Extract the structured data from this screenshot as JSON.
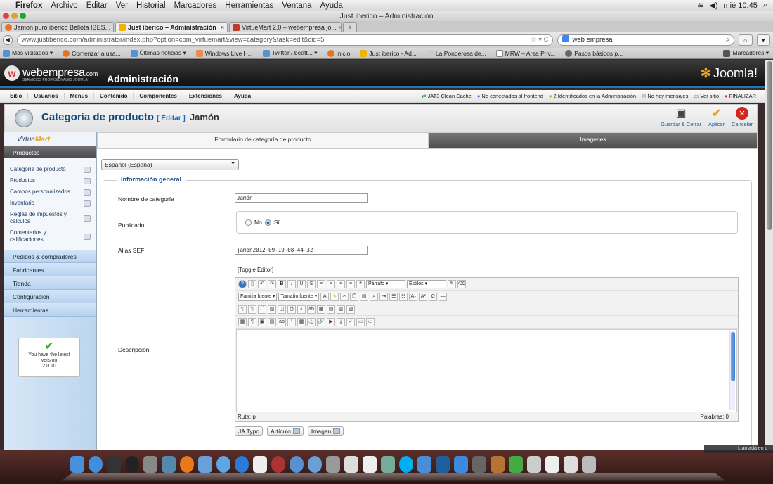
{
  "mac_menubar": {
    "app": "Firefox",
    "items": [
      "Archivo",
      "Editar",
      "Ver",
      "Historial",
      "Marcadores",
      "Herramientas",
      "Ventana",
      "Ayuda"
    ],
    "clock": "mié 10:45"
  },
  "window_title": "Just iberico – Administración",
  "browser_tabs": [
    {
      "label": "Jamon puro ibérico Bellota IBES...",
      "color": "#e8731c"
    },
    {
      "label": "Just iberico – Administración",
      "color": "#f0b400"
    },
    {
      "label": "VirtueMart 2.0 – webempresa jo...",
      "color": "#c0392b"
    }
  ],
  "url": "www.justiberico.com/administrator/index.php?option=com_virtuemart&view=category&task=edit&cid=5",
  "search_box": "web empresa",
  "bookmarks": [
    "Más visitados ▾",
    "Comenzar a usa...",
    "Últimas noticias ▾",
    "Windows Live H...",
    "Twitter / beatt... ▾",
    "Inicio",
    "Just iberico - Ad...",
    "La Ponderosa de...",
    "MRW – Area Priv...",
    "Pasos básicos p..."
  ],
  "bookmarks_menu": "Marcadores ▾",
  "joomla_header": {
    "brand": "webempresa",
    "brand_suffix": ".com",
    "brand_sub": "SERVICIOS PROFESIONALES JOOMLA",
    "title": "Administración",
    "joomla_logo": "Joomla!"
  },
  "admin_menu": [
    "Sitio",
    "Usuarios",
    "Menús",
    "Contenido",
    "Componentes",
    "Extensiones",
    "Ayuda"
  ],
  "admin_status": [
    "JAT3 Clean Cache",
    "No conectados al frontend",
    "2 Identificados en la Administración",
    "No hay mensajes",
    "Ver sitio",
    "FINALIZAR"
  ],
  "toolbar": {
    "title": "Categoría de producto",
    "edit_tag": "[ Editar ]",
    "item_name": "Jamón",
    "save_close": "Guardar & Cerrar",
    "apply": "Aplicar",
    "cancel": "Cancelar"
  },
  "sidebar": {
    "logo_a": "Virtue",
    "logo_b": "Mart",
    "active_section": "Productos",
    "subitems": [
      "Categoría de producto",
      "Productos",
      "Campos personalizados",
      "Inventario",
      "Reglas de impuestos y cálculos",
      "Comentarios y calificaciones"
    ],
    "sections": [
      "Pedidos & compradores",
      "Fabricantes",
      "Tienda",
      "Configuración",
      "Herramientas"
    ],
    "version_box": {
      "line1": "You have the latest",
      "line2": "version",
      "version": "2.0.10"
    }
  },
  "form_tabs": [
    "Formulario de categoría de producto",
    "Imagenes"
  ],
  "language_select": "Español (España)",
  "general_info": {
    "legend": "Información general",
    "name_label": "Nombre de categoría",
    "name_value": "Jamón",
    "published_label": "Publicado",
    "no_label": "No",
    "yes_label": "Sí",
    "alias_label": "Alias SEF",
    "alias_value": "jamon2012-09-19-08-44-32_",
    "toggle_editor": "[Toggle Editor]",
    "description_label": "Descripción"
  },
  "editor": {
    "format_select": "Párrafo",
    "styles_select": "Estilos",
    "font_family": "Familia fuente",
    "font_size": "Tamaño fuente",
    "path": "Ruta: p",
    "words": "Palabras: 0",
    "buttons": [
      "JA Typo",
      "Artículo",
      "Imagen"
    ]
  },
  "notification": "Llamada en c"
}
